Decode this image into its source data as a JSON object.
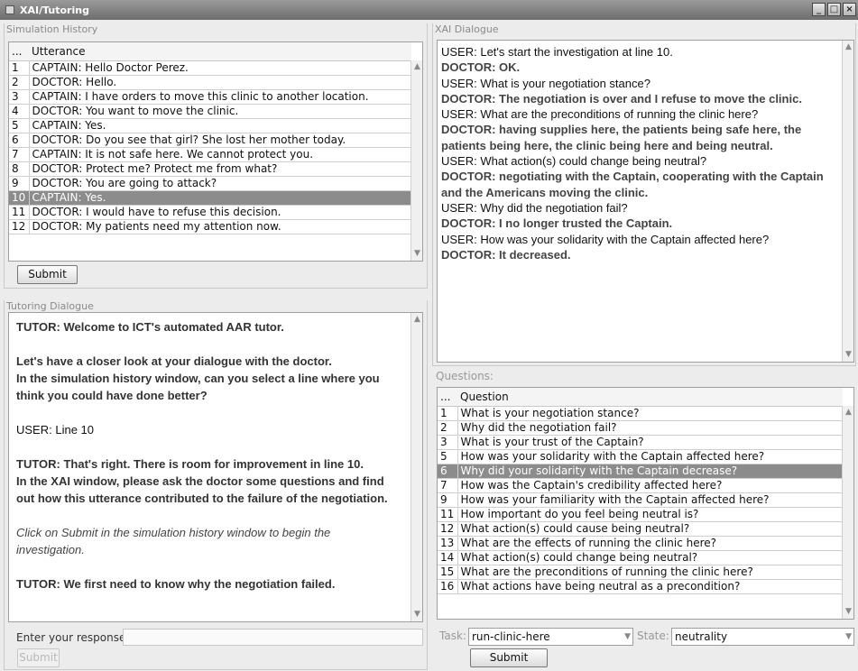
{
  "window": {
    "title": "XAI/Tutoring"
  },
  "simulation_history": {
    "title": "Simulation History",
    "columns": [
      "...",
      "Utterance"
    ],
    "rows": [
      {
        "n": "1",
        "text": "CAPTAIN: Hello Doctor Perez."
      },
      {
        "n": "2",
        "text": "DOCTOR: Hello."
      },
      {
        "n": "3",
        "text": "CAPTAIN: I have orders to move this clinic to another location."
      },
      {
        "n": "4",
        "text": "DOCTOR: You want to move the clinic."
      },
      {
        "n": "5",
        "text": "CAPTAIN: Yes."
      },
      {
        "n": "6",
        "text": "DOCTOR: Do you see that girl? She lost her mother today."
      },
      {
        "n": "7",
        "text": "CAPTAIN: It is not safe here. We cannot protect you."
      },
      {
        "n": "8",
        "text": "DOCTOR: Protect me? Protect me from what?"
      },
      {
        "n": "9",
        "text": "DOCTOR: You are going to attack?"
      },
      {
        "n": "10",
        "text": "CAPTAIN: Yes."
      },
      {
        "n": "11",
        "text": "DOCTOR: I would have to refuse this decision."
      },
      {
        "n": "12",
        "text": "DOCTOR: My patients need my attention now."
      }
    ],
    "selected_row": "10",
    "submit_label": "Submit"
  },
  "tutoring_dialogue": {
    "title": "Tutoring Dialogue",
    "t1": "TUTOR: Welcome to ICT's automated AAR tutor.",
    "t2a": "Let's have a closer look at your dialogue with the doctor.",
    "t2b": "In the simulation history window, can you select a line where you",
    "t2c": "think you could have done better?",
    "u1": "USER: Line 10",
    "t3a": "TUTOR: That's right. There is room for improvement in line 10.",
    "t3b": "In the XAI window, please ask the doctor some questions and find",
    "t3c": "out how this utterance contributed to the failure of the negotiation.",
    "i1a": "Click on Submit in the simulation history window to begin the",
    "i1b": "investigation.",
    "t4": "TUTOR: We first need to know why the negotiation failed.",
    "response_label": "Enter your response:",
    "response_value": "",
    "submit_label": "Submit"
  },
  "xai_dialogue": {
    "title": "XAI Dialogue",
    "lines": [
      {
        "speaker": "user",
        "text": "USER: Let's start the investigation at line 10."
      },
      {
        "speaker": "doctor",
        "text": "DOCTOR: OK."
      },
      {
        "speaker": "user",
        "text": "USER: What is your negotiation stance?"
      },
      {
        "speaker": "doctor",
        "text": "DOCTOR: The negotiation is over and I refuse to move the clinic."
      },
      {
        "speaker": "user",
        "text": "USER: What are the preconditions of running the clinic here?"
      },
      {
        "speaker": "doctor",
        "text": "DOCTOR: having supplies here, the patients being safe here, the"
      },
      {
        "speaker": "doctor",
        "text": "patients being here, the clinic being here and being neutral."
      },
      {
        "speaker": "user",
        "text": "USER: What action(s) could change being neutral?"
      },
      {
        "speaker": "doctor",
        "text": "DOCTOR: negotiating with the Captain, cooperating with the Captain"
      },
      {
        "speaker": "doctor",
        "text": "and the Americans moving the clinic."
      },
      {
        "speaker": "user",
        "text": "USER: Why did the negotiation fail?"
      },
      {
        "speaker": "doctor",
        "text": "DOCTOR: I no longer trusted the Captain."
      },
      {
        "speaker": "user",
        "text": "USER: How was your solidarity with the Captain affected here?"
      },
      {
        "speaker": "doctor",
        "text": "DOCTOR: It decreased."
      }
    ]
  },
  "questions": {
    "title": "Questions:",
    "columns": [
      "...",
      "Question"
    ],
    "rows": [
      {
        "n": "1",
        "text": "What is your negotiation stance?"
      },
      {
        "n": "2",
        "text": "Why did the negotiation fail?"
      },
      {
        "n": "3",
        "text": "What is your trust of the Captain?"
      },
      {
        "n": "5",
        "text": "How was your solidarity with the Captain affected here?"
      },
      {
        "n": "6",
        "text": "Why did your solidarity with the Captain decrease?"
      },
      {
        "n": "7",
        "text": "How was the Captain's credibility affected here?"
      },
      {
        "n": "9",
        "text": "How was your familiarity with the Captain affected here?"
      },
      {
        "n": "11",
        "text": "How important do you feel being neutral is?"
      },
      {
        "n": "12",
        "text": "What action(s) could cause being neutral?"
      },
      {
        "n": "13",
        "text": "What are the effects of running the clinic here?"
      },
      {
        "n": "14",
        "text": "What action(s) could change being neutral?"
      },
      {
        "n": "15",
        "text": "What are the preconditions of running the clinic here?"
      },
      {
        "n": "16",
        "text": "What actions have being neutral as a precondition?"
      }
    ],
    "selected_row": "6",
    "task_label": "Task:",
    "task_value": "run-clinic-here",
    "state_label": "State:",
    "state_value": "neutrality",
    "submit_label": "Submit"
  }
}
